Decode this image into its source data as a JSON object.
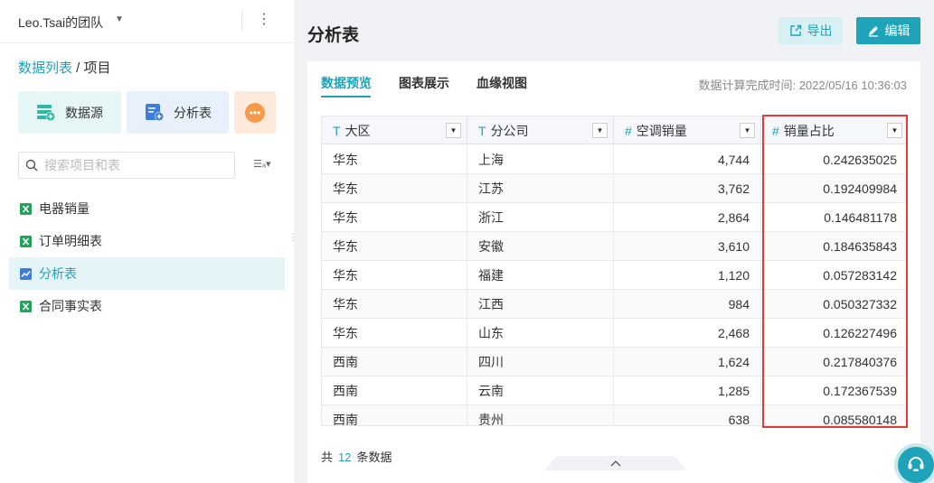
{
  "team": {
    "name": "Leo.Tsai的团队"
  },
  "breadcrumb": {
    "parent": "数据列表",
    "separator": " / ",
    "current": "项目"
  },
  "add_cards": {
    "datasource": "数据源",
    "analysis": "分析表"
  },
  "search": {
    "placeholder": "搜索项目和表",
    "value": ""
  },
  "nav": [
    {
      "label": "电器销量",
      "icon": "excel-icon"
    },
    {
      "label": "订单明细表",
      "icon": "excel-icon"
    },
    {
      "label": "分析表",
      "icon": "analysis-chart-icon",
      "active": true
    },
    {
      "label": "合同事实表",
      "icon": "excel-icon"
    }
  ],
  "main": {
    "title": "分析表",
    "export_label": "导出",
    "edit_label": "编辑",
    "tabs": [
      "数据预览",
      "图表展示",
      "血缘视图"
    ],
    "active_tab": "数据预览",
    "calc_time_label": "数据计算完成时间:",
    "calc_time": "2022/05/16 10:36:03"
  },
  "table": {
    "columns": [
      {
        "type_icon": "T",
        "label": "大区"
      },
      {
        "type_icon": "T",
        "label": "分公司"
      },
      {
        "type_icon": "#",
        "label": "空调销量"
      },
      {
        "type_icon": "#",
        "label": "销量占比"
      }
    ],
    "rows": [
      [
        "华东",
        "上海",
        "4,744",
        "0.242635025"
      ],
      [
        "华东",
        "江苏",
        "3,762",
        "0.192409984"
      ],
      [
        "华东",
        "浙江",
        "2,864",
        "0.146481178"
      ],
      [
        "华东",
        "安徽",
        "3,610",
        "0.184635843"
      ],
      [
        "华东",
        "福建",
        "1,120",
        "0.057283142"
      ],
      [
        "华东",
        "江西",
        "984",
        "0.050327332"
      ],
      [
        "华东",
        "山东",
        "2,468",
        "0.126227496"
      ],
      [
        "西南",
        "四川",
        "1,624",
        "0.217840376"
      ],
      [
        "西南",
        "云南",
        "1,285",
        "0.172367539"
      ],
      [
        "西南",
        "贵州",
        "638",
        "0.085580148"
      ]
    ]
  },
  "footer": {
    "prefix": "共",
    "count": "12",
    "suffix": "条数据"
  },
  "colors": {
    "accent": "#1fa3b8",
    "highlight": "#e23b3b"
  }
}
